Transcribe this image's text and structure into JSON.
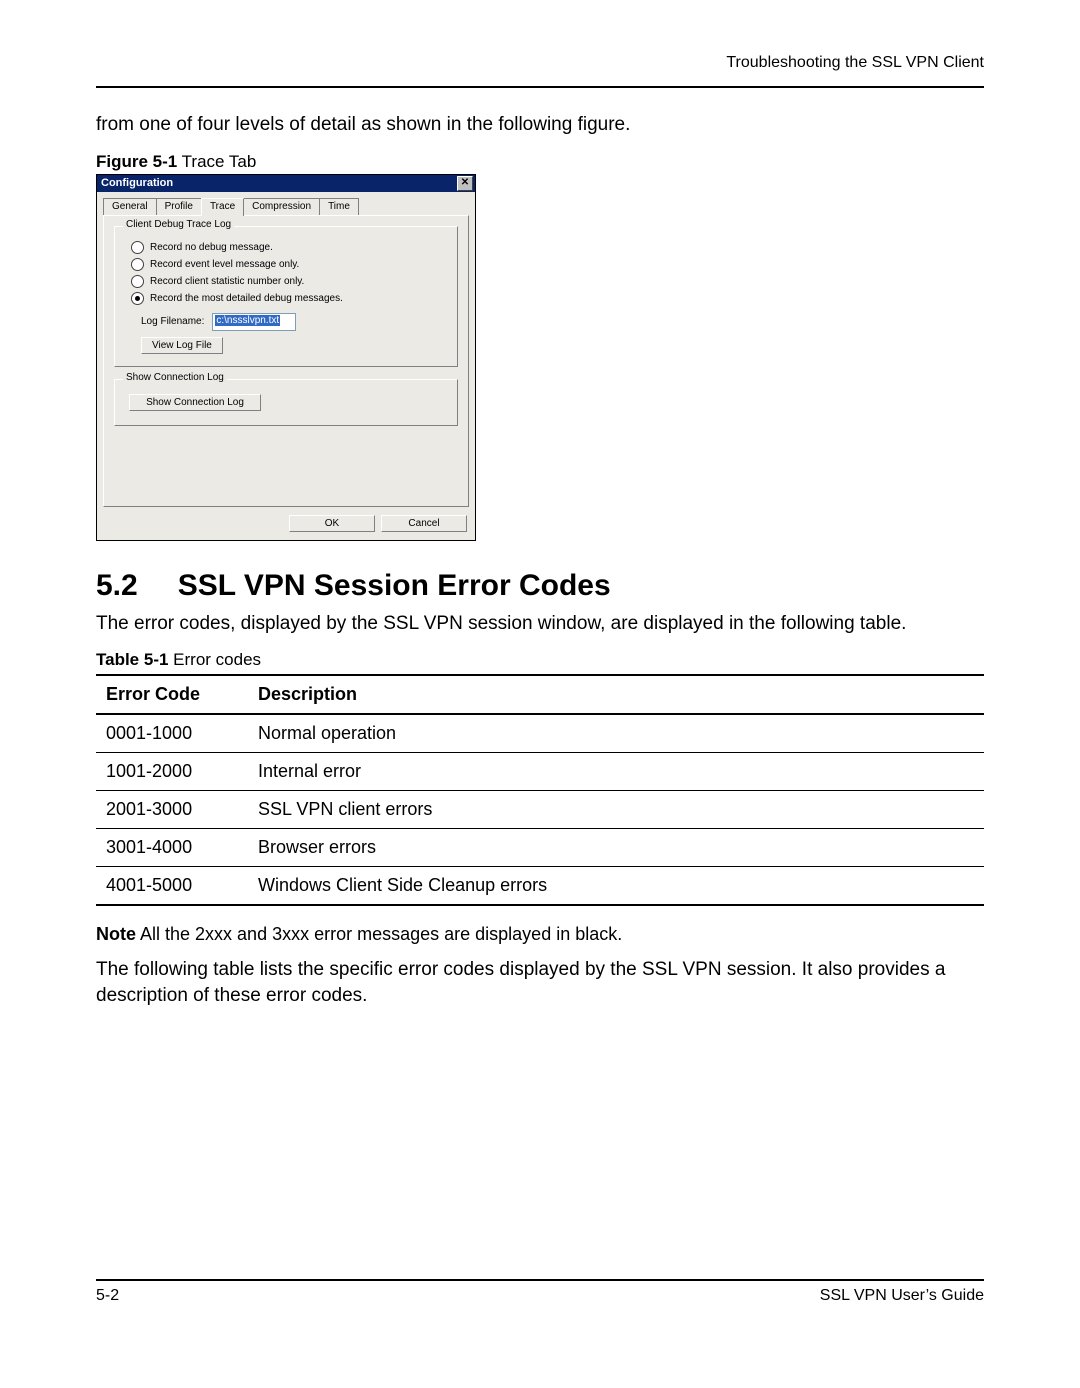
{
  "header": {
    "running_head": "Troubleshooting the SSL VPN Client"
  },
  "intro_text": "from one of four levels of detail as shown in the following figure.",
  "figure": {
    "label_bold": "Figure 5-1",
    "label_rest": "  Trace Tab"
  },
  "dialog": {
    "title": "Configuration",
    "close_glyph": "✕",
    "tabs": {
      "general": "General",
      "profile": "Profile",
      "trace": "Trace",
      "compression": "Compression",
      "time": "Time"
    },
    "group1": {
      "legend": "Client Debug Trace Log",
      "opt1": "Record no debug message.",
      "opt2": "Record event level message only.",
      "opt3": "Record client statistic number only.",
      "opt4": "Record the most detailed debug messages.",
      "filename_label": "Log Filename:",
      "filename_value": "c:\\nssslvpn.txt",
      "view_btn": "View Log File"
    },
    "group2": {
      "legend": "Show Connection Log",
      "show_btn": "Show Connection Log"
    },
    "ok": "OK",
    "cancel": "Cancel"
  },
  "section": {
    "number": "5.2",
    "title": "SSL VPN Session Error Codes"
  },
  "section_intro": "The error codes, displayed by the SSL VPN session window, are displayed in the following table.",
  "table_label": {
    "bold": "Table 5-1",
    "rest": "  Error codes"
  },
  "table": {
    "head": {
      "c1": "Error Code",
      "c2": "Description"
    },
    "rows": [
      {
        "c1": "0001-1000",
        "c2": "Normal operation"
      },
      {
        "c1": "1001-2000",
        "c2": "Internal error"
      },
      {
        "c1": "2001-3000",
        "c2": "SSL VPN client errors"
      },
      {
        "c1": "3001-4000",
        "c2": "Browser errors"
      },
      {
        "c1": "4001-5000",
        "c2": "Windows Client Side Cleanup errors"
      }
    ]
  },
  "note": {
    "bold": "Note",
    "text": " All the 2xxx and 3xxx error messages are displayed in black."
  },
  "closing_text": "The following table lists the specific error codes displayed by the SSL VPN session. It also provides a description of these error codes.",
  "footer": {
    "left": "5-2",
    "right": "SSL VPN User’s Guide"
  }
}
